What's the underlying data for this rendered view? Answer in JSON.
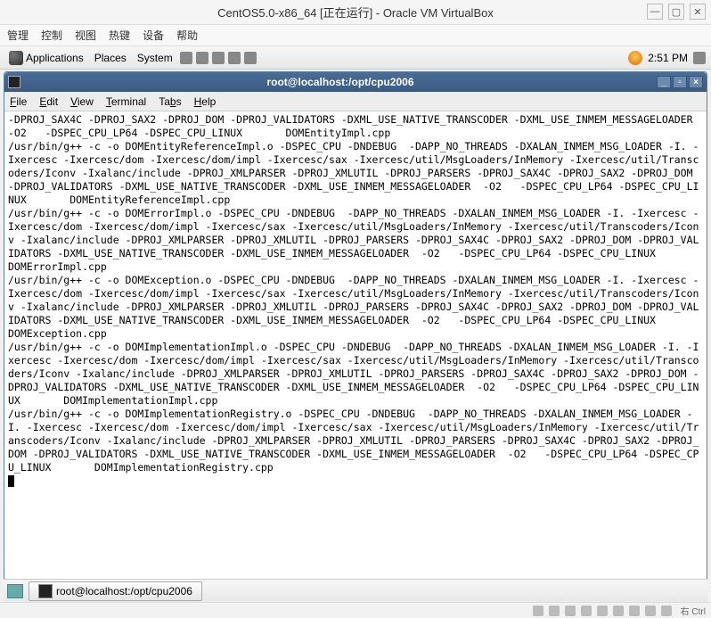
{
  "virtualbox": {
    "title": "CentOS5.0-x86_64 [正在运行] - Oracle VM VirtualBox",
    "controls": {
      "min": "—",
      "max": "▢",
      "close": "✕"
    },
    "menu": [
      "管理",
      "控制",
      "视图",
      "热键",
      "设备",
      "帮助"
    ],
    "status_right": "右 Ctrl"
  },
  "gnome": {
    "top_items": [
      "Applications",
      "Places",
      "System"
    ],
    "clock": "2:51 PM",
    "taskbar_item": "root@localhost:/opt/cpu2006"
  },
  "terminal": {
    "title": "root@localhost:/opt/cpu2006",
    "menu": [
      "File",
      "Edit",
      "View",
      "Terminal",
      "Tabs",
      "Help"
    ],
    "controls": {
      "min": "_",
      "max": "▫",
      "close": "×"
    },
    "output": "-DPROJ_SAX4C -DPROJ_SAX2 -DPROJ_DOM -DPROJ_VALIDATORS -DXML_USE_NATIVE_TRANSCODER -DXML_USE_INMEM_MESSAGELOADER  -O2   -DSPEC_CPU_LP64 -DSPEC_CPU_LINUX       DOMEntityImpl.cpp\n/usr/bin/g++ -c -o DOMEntityReferenceImpl.o -DSPEC_CPU -DNDEBUG  -DAPP_NO_THREADS -DXALAN_INMEM_MSG_LOADER -I. -Ixercesc -Ixercesc/dom -Ixercesc/dom/impl -Ixercesc/sax -Ixercesc/util/MsgLoaders/InMemory -Ixercesc/util/Transcoders/Iconv -Ixalanc/include -DPROJ_XMLPARSER -DPROJ_XMLUTIL -DPROJ_PARSERS -DPROJ_SAX4C -DPROJ_SAX2 -DPROJ_DOM -DPROJ_VALIDATORS -DXML_USE_NATIVE_TRANSCODER -DXML_USE_INMEM_MESSAGELOADER  -O2   -DSPEC_CPU_LP64 -DSPEC_CPU_LINUX       DOMEntityReferenceImpl.cpp\n/usr/bin/g++ -c -o DOMErrorImpl.o -DSPEC_CPU -DNDEBUG  -DAPP_NO_THREADS -DXALAN_INMEM_MSG_LOADER -I. -Ixercesc -Ixercesc/dom -Ixercesc/dom/impl -Ixercesc/sax -Ixercesc/util/MsgLoaders/InMemory -Ixercesc/util/Transcoders/Iconv -Ixalanc/include -DPROJ_XMLPARSER -DPROJ_XMLUTIL -DPROJ_PARSERS -DPROJ_SAX4C -DPROJ_SAX2 -DPROJ_DOM -DPROJ_VALIDATORS -DXML_USE_NATIVE_TRANSCODER -DXML_USE_INMEM_MESSAGELOADER  -O2   -DSPEC_CPU_LP64 -DSPEC_CPU_LINUX       DOMErrorImpl.cpp\n/usr/bin/g++ -c -o DOMException.o -DSPEC_CPU -DNDEBUG  -DAPP_NO_THREADS -DXALAN_INMEM_MSG_LOADER -I. -Ixercesc -Ixercesc/dom -Ixercesc/dom/impl -Ixercesc/sax -Ixercesc/util/MsgLoaders/InMemory -Ixercesc/util/Transcoders/Iconv -Ixalanc/include -DPROJ_XMLPARSER -DPROJ_XMLUTIL -DPROJ_PARSERS -DPROJ_SAX4C -DPROJ_SAX2 -DPROJ_DOM -DPROJ_VALIDATORS -DXML_USE_NATIVE_TRANSCODER -DXML_USE_INMEM_MESSAGELOADER  -O2   -DSPEC_CPU_LP64 -DSPEC_CPU_LINUX       DOMException.cpp\n/usr/bin/g++ -c -o DOMImplementationImpl.o -DSPEC_CPU -DNDEBUG  -DAPP_NO_THREADS -DXALAN_INMEM_MSG_LOADER -I. -Ixercesc -Ixercesc/dom -Ixercesc/dom/impl -Ixercesc/sax -Ixercesc/util/MsgLoaders/InMemory -Ixercesc/util/Transcoders/Iconv -Ixalanc/include -DPROJ_XMLPARSER -DPROJ_XMLUTIL -DPROJ_PARSERS -DPROJ_SAX4C -DPROJ_SAX2 -DPROJ_DOM -DPROJ_VALIDATORS -DXML_USE_NATIVE_TRANSCODER -DXML_USE_INMEM_MESSAGELOADER  -O2   -DSPEC_CPU_LP64 -DSPEC_CPU_LINUX       DOMImplementationImpl.cpp\n/usr/bin/g++ -c -o DOMImplementationRegistry.o -DSPEC_CPU -DNDEBUG  -DAPP_NO_THREADS -DXALAN_INMEM_MSG_LOADER -I. -Ixercesc -Ixercesc/dom -Ixercesc/dom/impl -Ixercesc/sax -Ixercesc/util/MsgLoaders/InMemory -Ixercesc/util/Transcoders/Iconv -Ixalanc/include -DPROJ_XMLPARSER -DPROJ_XMLUTIL -DPROJ_PARSERS -DPROJ_SAX4C -DPROJ_SAX2 -DPROJ_DOM -DPROJ_VALIDATORS -DXML_USE_NATIVE_TRANSCODER -DXML_USE_INMEM_MESSAGELOADER  -O2   -DSPEC_CPU_LP64 -DSPEC_CPU_LINUX       DOMImplementationRegistry.cpp"
  }
}
